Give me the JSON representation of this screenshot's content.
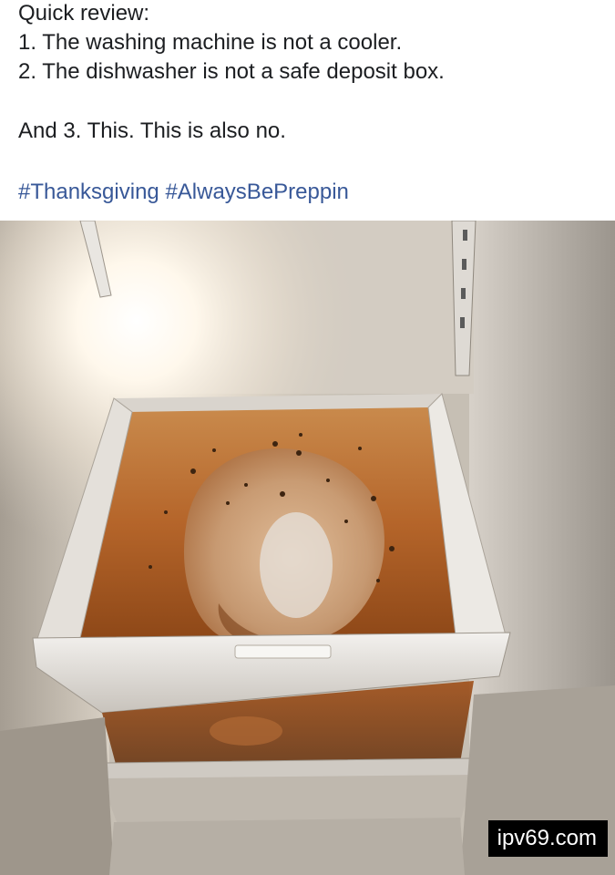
{
  "post": {
    "lines": [
      "Quick review:",
      "1. The washing machine is not a cooler.",
      "2. The dishwasher is not a safe deposit box.",
      "And 3. This. This is also no."
    ],
    "hashtags": [
      "#Thanksgiving",
      "#AlwaysBePreppin"
    ]
  },
  "photo": {
    "subject": "turkey-thawing-in-refrigerator-crisper-drawer",
    "watermark": "ipv69.com"
  },
  "colors": {
    "text": "#1c1e21",
    "hashtag": "#385898",
    "brine": "#b5652a"
  }
}
